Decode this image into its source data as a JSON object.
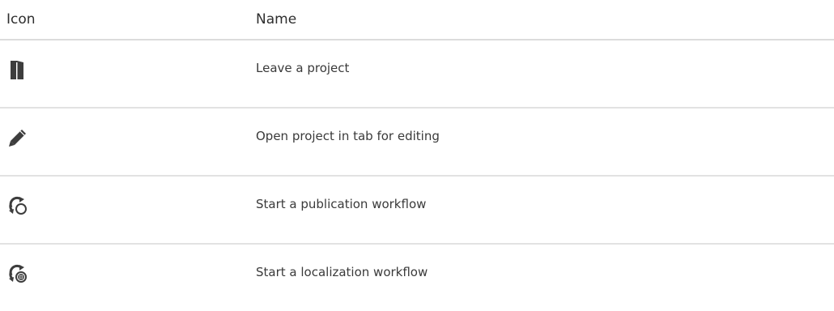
{
  "table": {
    "headers": {
      "icon": "Icon",
      "name": "Name"
    },
    "rows": [
      {
        "icon": "leave-project-door-icon",
        "name": "Leave a project"
      },
      {
        "icon": "pencil-edit-icon",
        "name": "Open project in tab for editing"
      },
      {
        "icon": "publication-workflow-icon",
        "name": "Start a publication workflow"
      },
      {
        "icon": "localization-workflow-icon",
        "name": "Start a localization workflow"
      }
    ]
  },
  "colors": {
    "icon": "#3d3d3d",
    "text": "#3a3a3a",
    "divider": "#e2e2e2"
  }
}
